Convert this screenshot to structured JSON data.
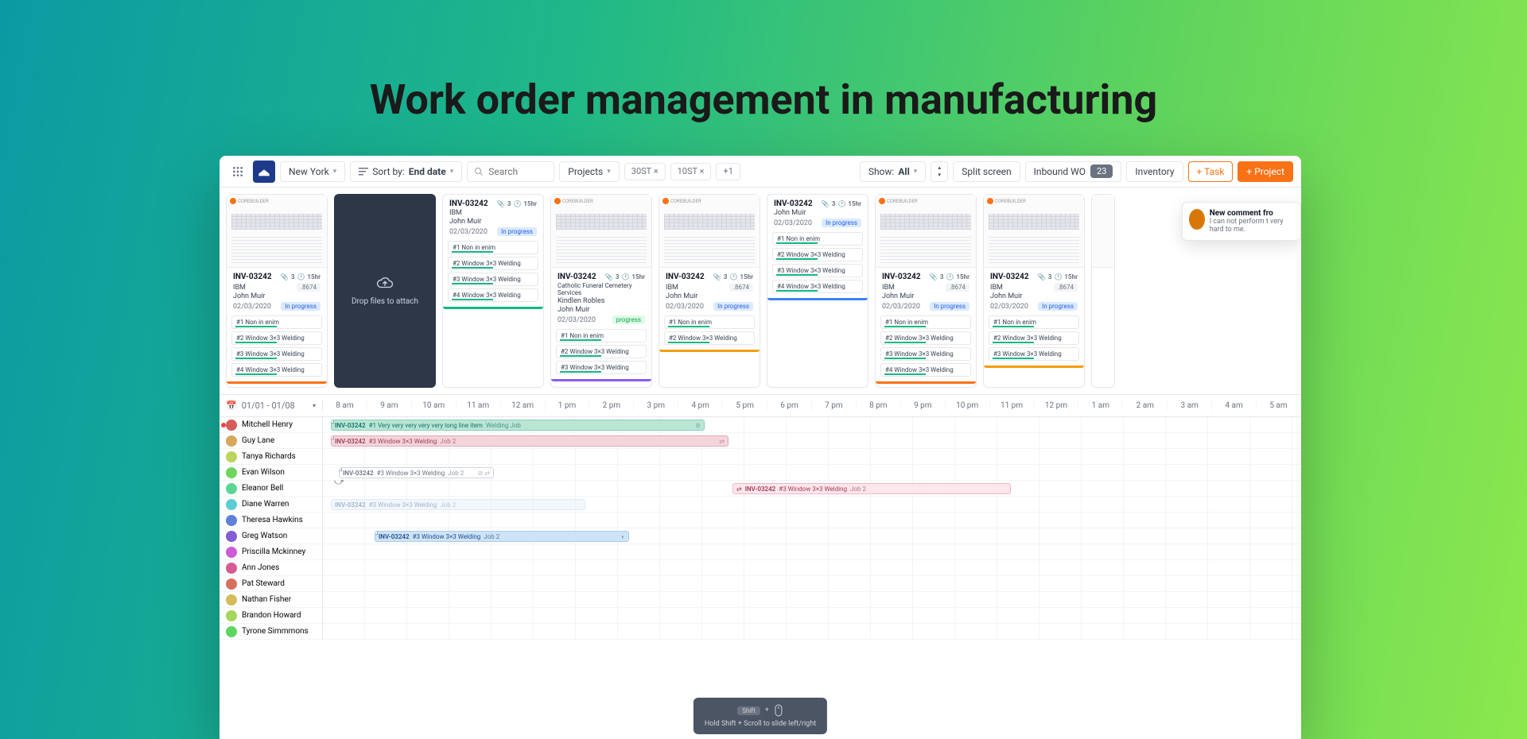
{
  "hero_title": "Work order management in manufacturing",
  "toolbar": {
    "location_dropdown": "New York",
    "sort_prefix": "Sort by:",
    "sort_value": "End date",
    "search_placeholder": "Search",
    "projects_dropdown": "Projects",
    "chips": [
      "30ST ×",
      "10ST ×",
      "+1"
    ],
    "show_label": "Show:",
    "show_value": "All",
    "split_screen": "Split screen",
    "inbound_wo": "Inbound WO",
    "inbound_count": "23",
    "inventory": "Inventory",
    "add_task": "+ Task",
    "add_project": "+ Project"
  },
  "cards": {
    "thumb_logo": "COREBUILDER",
    "inv": "INV-03242",
    "ibm": "IBM",
    "john_muir": "John Muir",
    "date": "02/03/2020",
    "in_progress": "In progress",
    "attach_count": "3",
    "hours": "15hr",
    "pill": ".8674",
    "cath": "Catholic Funeral Cemetery Services",
    "kindlen": "Kindlen Robles",
    "drop_text": "Drop files to attach",
    "tasks": {
      "t1": "#1 Non in enim",
      "t2": "#2 Window 3×3 Welding",
      "t3": "#3 Window 3×3 Welding",
      "t4": "#4 Window 3×3 Welding"
    }
  },
  "comment": {
    "title": "New comment fro",
    "text": "I can not perform t very hard to me."
  },
  "schedule": {
    "date_range": "01/01 - 01/08",
    "time_cols": [
      "8 am",
      "9 am",
      "10 am",
      "11 am",
      "12 am",
      "1 pm",
      "2 pm",
      "3 pm",
      "4 pm",
      "5 pm",
      "6 pm",
      "7 pm",
      "8 pm",
      "9 pm",
      "10 pm",
      "11 pm",
      "12 pm",
      "1 am",
      "2 am",
      "3 am",
      "4 am",
      "5 am"
    ],
    "people": [
      "Mitchell Henry",
      "Guy Lane",
      "Tanya Richards",
      "Evan Wilson",
      "Eleanor Bell",
      "Diane Warren",
      "Theresa Hawkins",
      "Greg Watson",
      "Priscilla Mckinney",
      "Ann Jones",
      "Pat Steward",
      "Nathan Fisher",
      "Brandon Howard",
      "Tyrone Simmmons"
    ],
    "bar_inv": "INV-03242",
    "bar1_task": "#1 Very very very very very long line item",
    "bar1_job": "Welding Job",
    "bar2_task": "#3 Window 3×3 Welding",
    "bar2_job": "Job 2",
    "bar_faded_task": "#3 Window 3×3 Welding",
    "bar_faded_job": "Job 2"
  },
  "hint": {
    "key": "Shift",
    "plus": "+",
    "text": "Hold Shift + Scroll to slide left/right"
  }
}
